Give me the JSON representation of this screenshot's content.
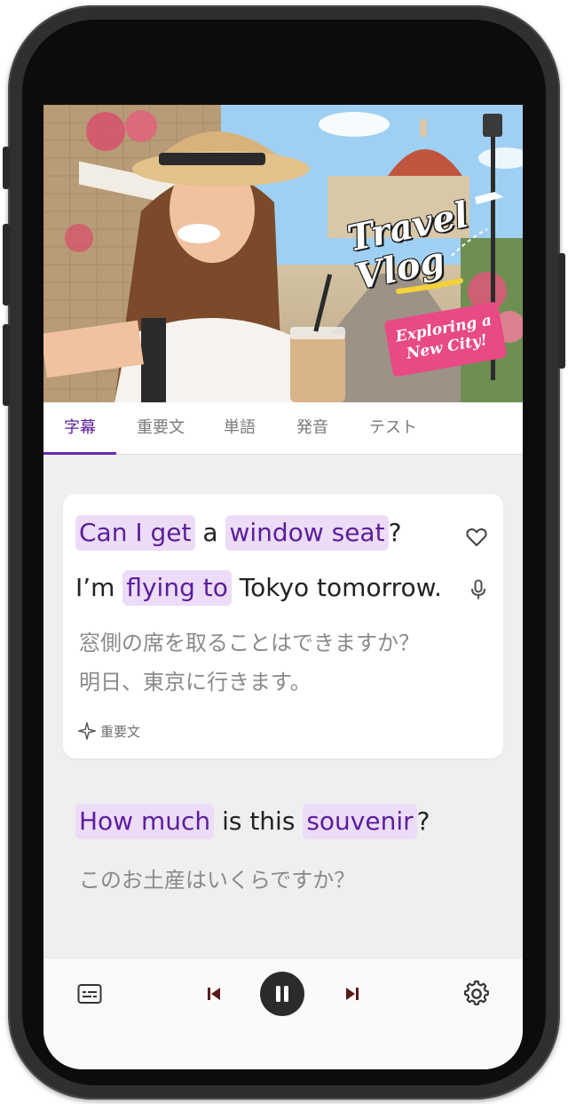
{
  "video": {
    "overlay_title": "Travel Vlog",
    "overlay_badge": "Exploring a New City!"
  },
  "tabs": [
    {
      "label": "字幕",
      "active": true
    },
    {
      "label": "重要文",
      "active": false
    },
    {
      "label": "単語",
      "active": false
    },
    {
      "label": "発音",
      "active": false
    },
    {
      "label": "テスト",
      "active": false
    }
  ],
  "subtitle_card": {
    "line1": {
      "hl1": "Can I get",
      "mid": "a",
      "hl2": "window seat",
      "end": "?"
    },
    "line2": {
      "start": "I’m",
      "hl1": "flying to",
      "end": "Tokyo tomorrow."
    },
    "translation1": "窓側の席を取ることはできますか？",
    "translation2": "明日、東京に行きます。",
    "tag": "重要文"
  },
  "subtitle_next": {
    "line1": {
      "hl1": "How much",
      "mid": "is this",
      "hl2": "souvenir",
      "end": "?"
    },
    "translation": "このお土産はいくらですか？"
  },
  "icons": {
    "favorite": "heart-icon",
    "pronounce": "mic-icon",
    "key_sentence": "sparkle-icon",
    "subtitles_toggle": "subtitles-icon",
    "previous": "skip-previous-icon",
    "pause": "pause-icon",
    "next": "skip-next-icon",
    "settings": "gear-icon"
  },
  "colors": {
    "accent": "#5b1f9a",
    "highlight": "#ecdcf7",
    "badge": "#e84a86"
  }
}
